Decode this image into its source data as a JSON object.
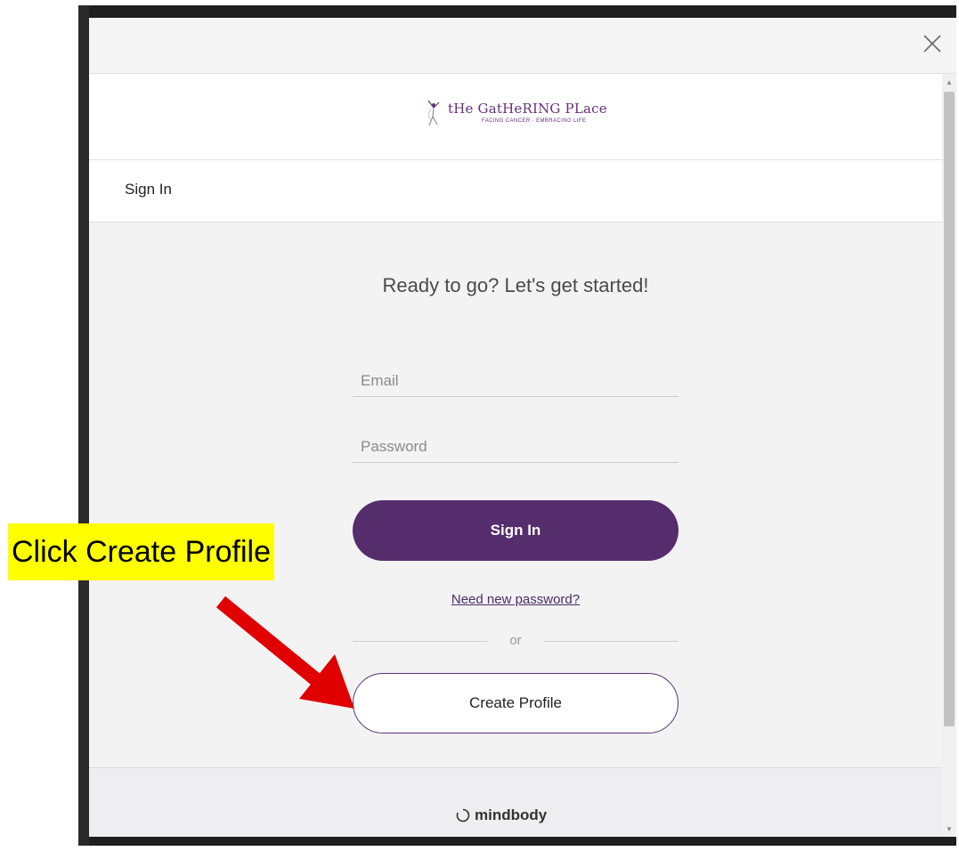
{
  "modal": {
    "close_label": "✕"
  },
  "logo": {
    "name": "tHe GatHeRING PLace",
    "tagline": "FACING CANCER · EMBRACING LIFE"
  },
  "section_title": "Sign In",
  "headline": "Ready to go? Let's get started!",
  "form": {
    "email_placeholder": "Email",
    "password_placeholder": "Password",
    "signin_button": "Sign In",
    "forgot_link": "Need new password?",
    "or_text": "or",
    "create_button": "Create Profile"
  },
  "footer": {
    "brand": "mindbody"
  },
  "annotation": {
    "callout": "Click Create Profile",
    "callout_bg": "#ffff00",
    "arrow_color": "#e00000"
  },
  "colors": {
    "accent": "#562d6c",
    "brand": "#6b2f7a"
  }
}
